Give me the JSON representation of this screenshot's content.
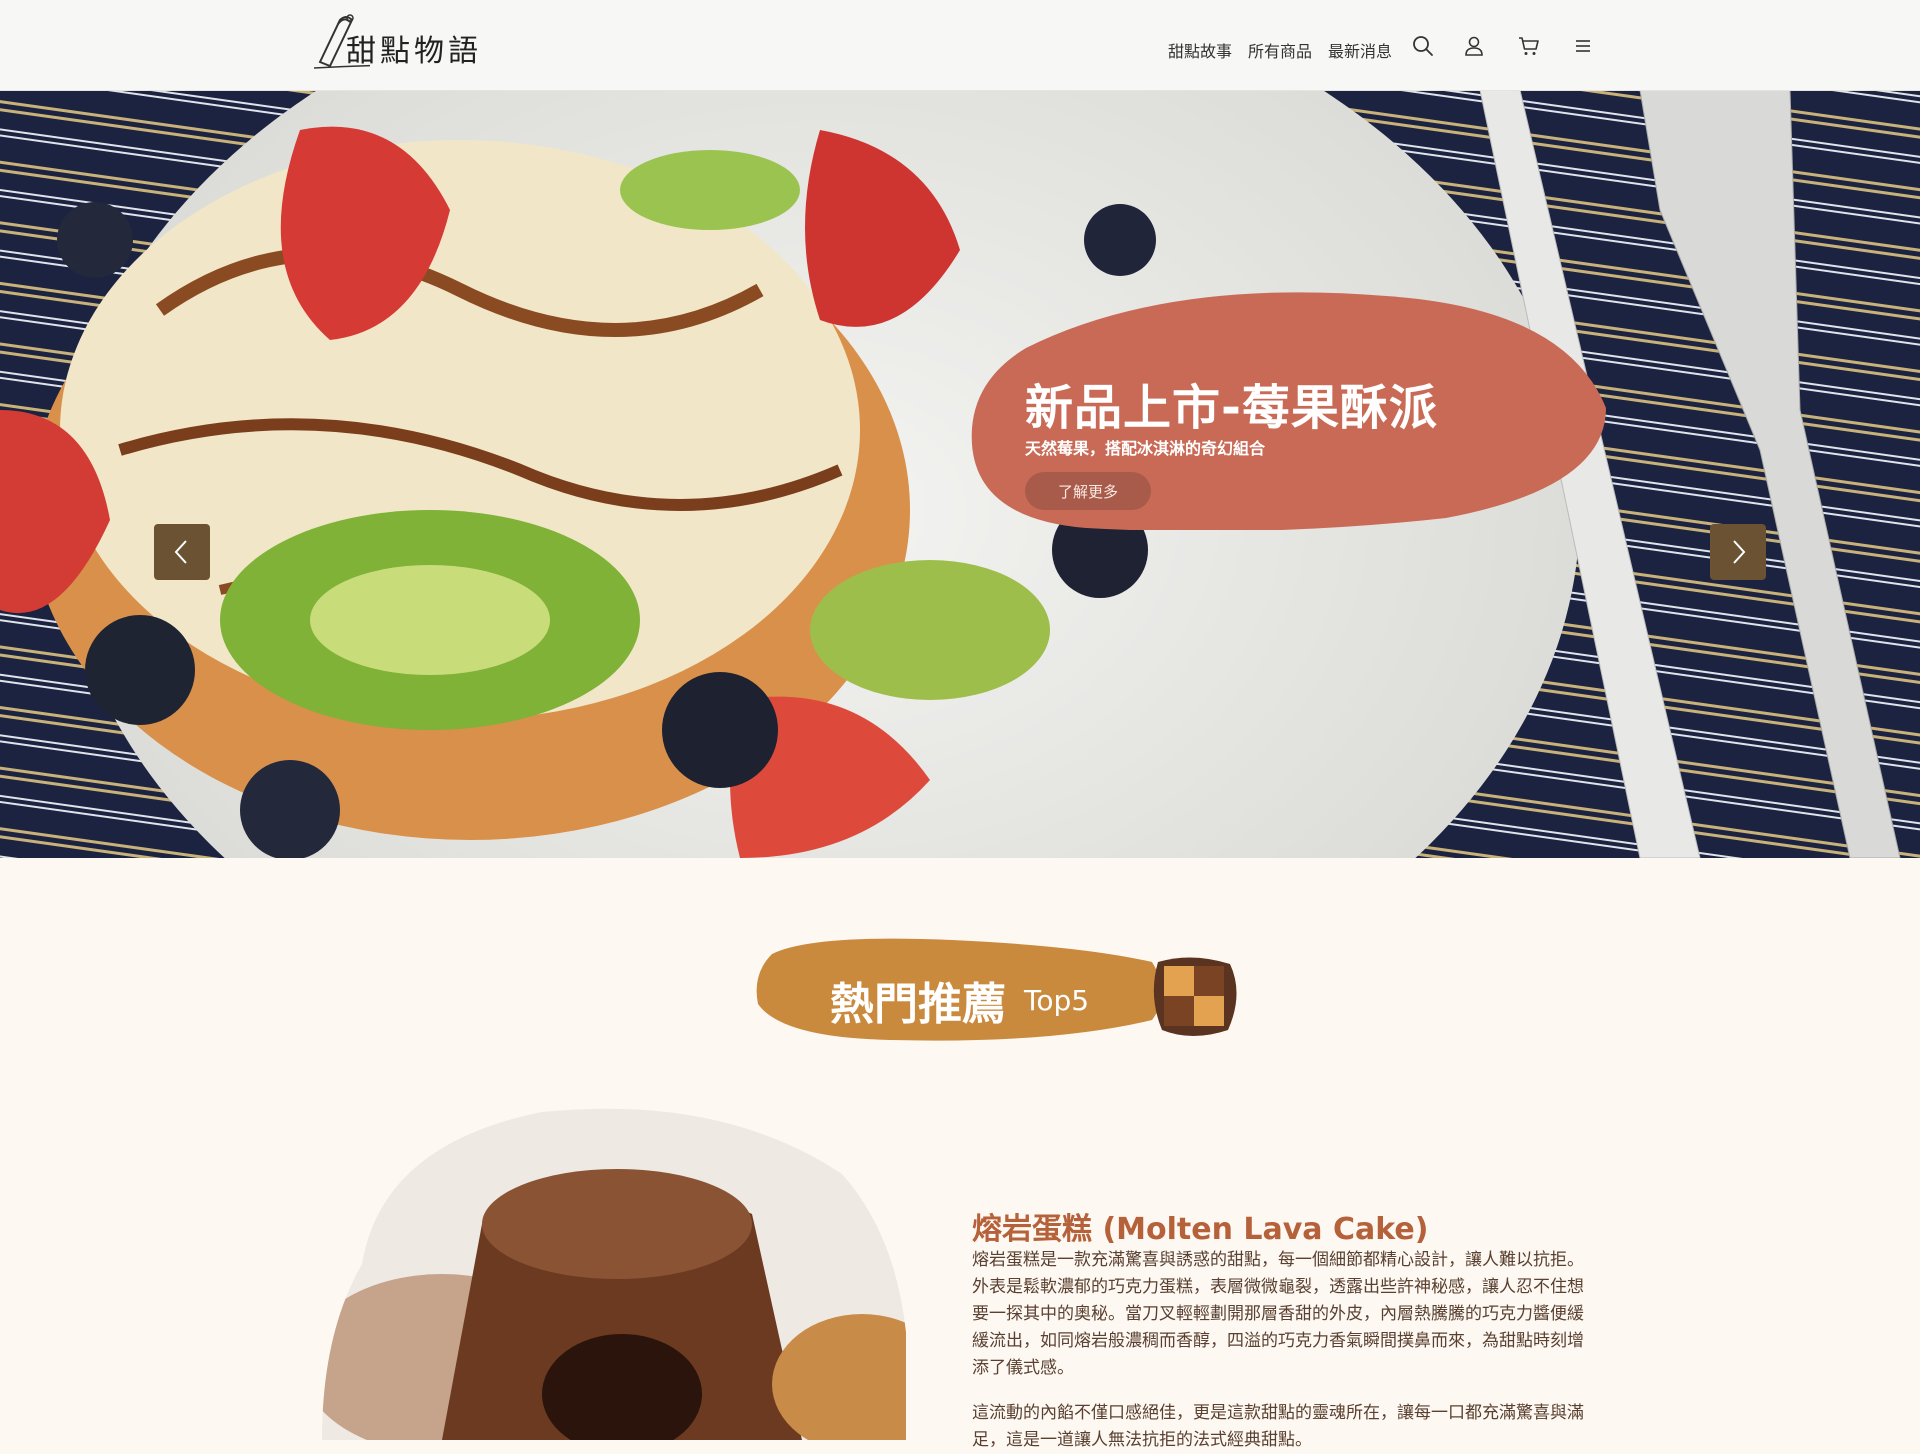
{
  "brand": {
    "logo_text": "甜點物語"
  },
  "nav": {
    "items": [
      "甜點故事",
      "所有商品",
      "最新消息"
    ],
    "icons": [
      "search-icon",
      "user-icon",
      "cart-icon",
      "menu-icon"
    ]
  },
  "hero": {
    "title": "新品上市-莓果酥派",
    "subtitle": "天然莓果，搭配冰淇淋的奇幻組合",
    "button": "了解更多",
    "bubble_color": "#c96a56",
    "arrow_color": "#6b5232"
  },
  "section": {
    "title": "熱門推薦",
    "title_suffix": "Top5",
    "badge_color": "#c98a3e"
  },
  "product": {
    "name": "熔岩蛋糕 (Molten Lava Cake)",
    "desc1": "熔岩蛋糕是一款充滿驚喜與誘惑的甜點，每一個細節都精心設計，讓人難以抗拒。外表是鬆軟濃郁的巧克力蛋糕，表層微微龜裂，透露出些許神秘感，讓人忍不住想要一探其中的奧秘。當刀叉輕輕劃開那層香甜的外皮，內層熱騰騰的巧克力醬便緩緩流出，如同熔岩般濃稠而香醇，四溢的巧克力香氣瞬間撲鼻而來，為甜點時刻增添了儀式感。",
    "desc2": "這流動的內餡不僅口感絕佳，更是這款甜點的靈魂所在，讓每一口都充滿驚喜與滿足，這是一道讓人無法抗拒的法式經典甜點。",
    "name_color": "#b5613a"
  }
}
